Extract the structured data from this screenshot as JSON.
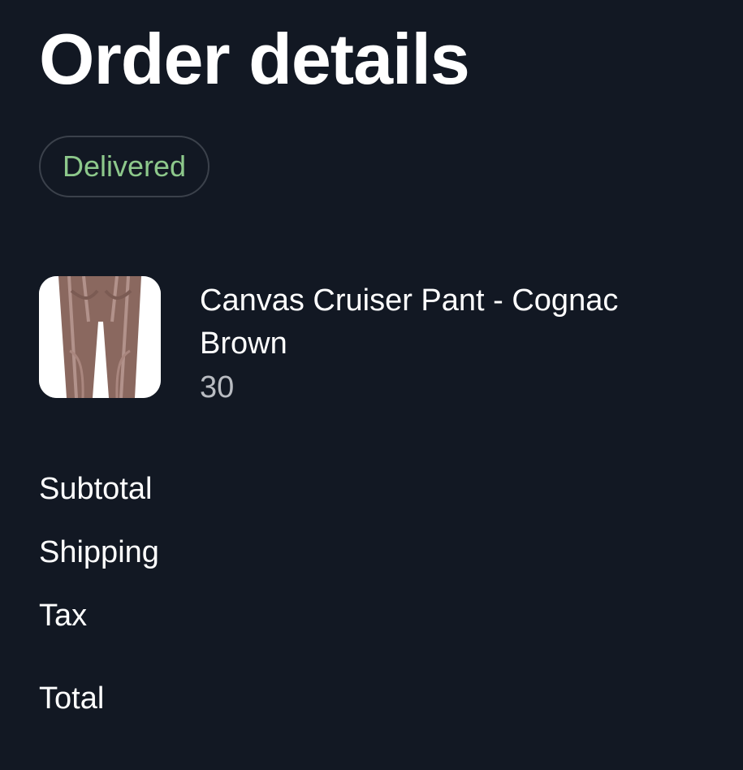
{
  "page": {
    "title": "Order details"
  },
  "status": {
    "label": "Delivered",
    "color": "#8dc88b"
  },
  "items": [
    {
      "name": "Canvas Cruiser Pant - Cognac Brown",
      "variant": "30",
      "thumbnail_icon": "pants-product-image"
    }
  ],
  "summary": {
    "subtotal_label": "Subtotal",
    "shipping_label": "Shipping",
    "tax_label": "Tax",
    "total_label": "Total"
  },
  "colors": {
    "background": "#121823",
    "text": "#ffffff",
    "muted_text": "#b9bcc2",
    "badge_border": "#3b414b"
  }
}
